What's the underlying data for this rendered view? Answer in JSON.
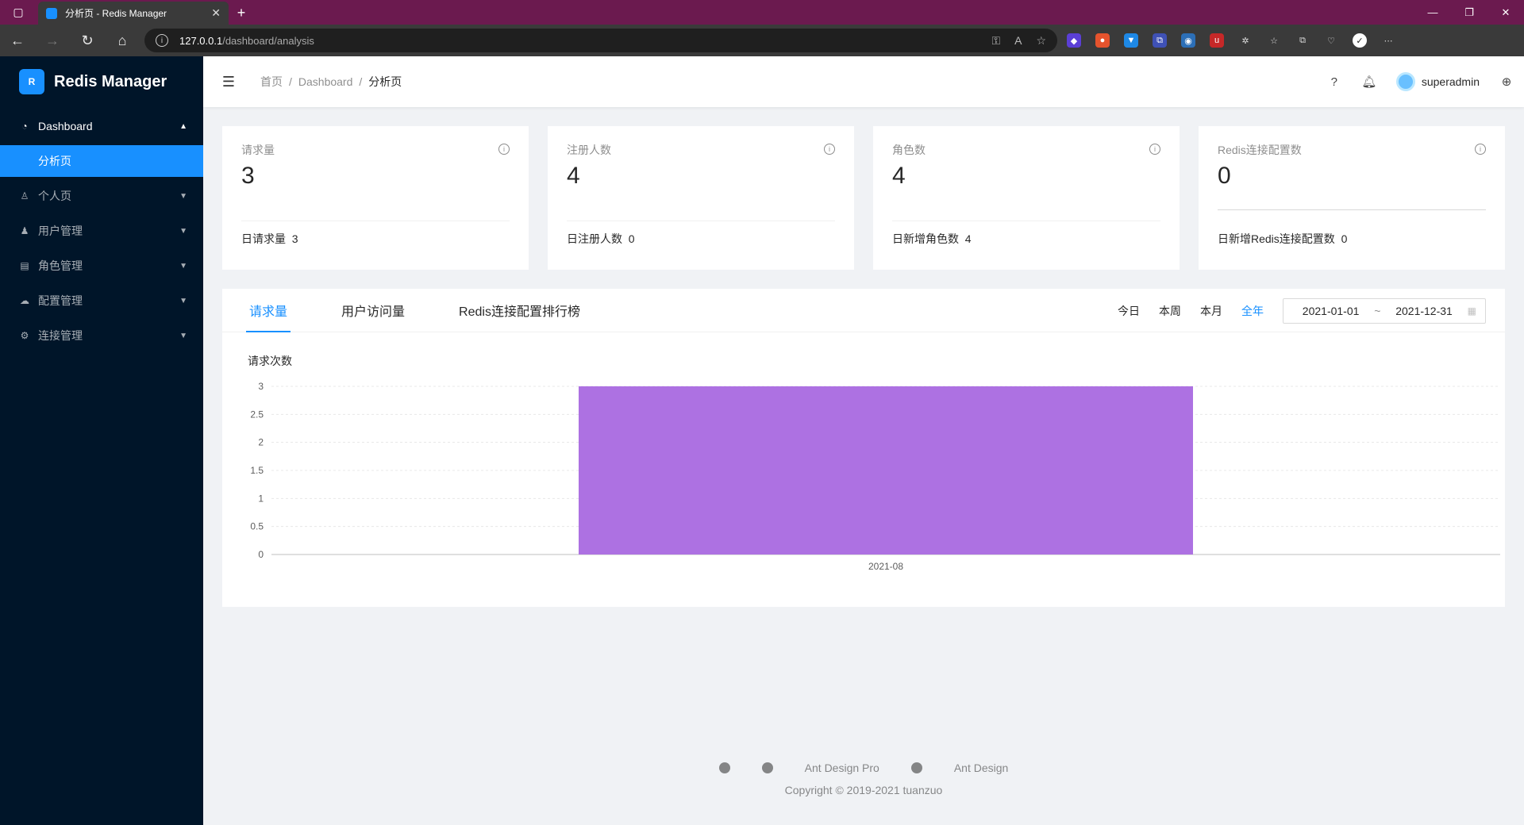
{
  "browser": {
    "tab_title": "分析页 - Redis Manager",
    "new_tab_icon": "plus-icon",
    "url_host": "127.0.0.1",
    "url_path": "/dashboard/analysis"
  },
  "app": {
    "logo_text": "Redis Manager"
  },
  "sidebar": {
    "items": [
      {
        "label": "Dashboard",
        "icon": "dashboard-icon",
        "open": true
      },
      {
        "label": "个人页",
        "icon": "user-icon"
      },
      {
        "label": "用户管理",
        "icon": "team-icon"
      },
      {
        "label": "角色管理",
        "icon": "role-icon"
      },
      {
        "label": "配置管理",
        "icon": "setting-cloud-icon"
      },
      {
        "label": "连接管理",
        "icon": "gear-icon"
      }
    ],
    "sub_items": [
      {
        "label": "分析页",
        "selected": true
      }
    ]
  },
  "header": {
    "breadcrumb": [
      "首页",
      "Dashboard",
      "分析页"
    ],
    "username": "superadmin"
  },
  "stats": [
    {
      "title": "请求量",
      "value": "3",
      "footer_label": "日请求量",
      "footer_value": "3"
    },
    {
      "title": "注册人数",
      "value": "4",
      "footer_label": "日注册人数",
      "footer_value": "0"
    },
    {
      "title": "角色数",
      "value": "4",
      "footer_label": "日新增角色数",
      "footer_value": "4"
    },
    {
      "title": "Redis连接配置数",
      "value": "0",
      "footer_label": "日新增Redis连接配置数",
      "footer_value": "0"
    }
  ],
  "sales": {
    "tabs": [
      "请求量",
      "用户访问量",
      "Redis连接配置排行榜"
    ],
    "active_tab": 0,
    "ranges": [
      "今日",
      "本周",
      "本月",
      "全年"
    ],
    "active_range": 3,
    "date_start": "2021-01-01",
    "date_separator": "~",
    "date_end": "2021-12-31",
    "chart_title": "请求次数"
  },
  "chart_data": {
    "type": "bar",
    "categories": [
      "2021-08"
    ],
    "values": [
      3
    ],
    "ylim": [
      0,
      3
    ],
    "yticks": [
      "0",
      "0.5",
      "1",
      "1.5",
      "2",
      "2.5",
      "3"
    ],
    "color": "#ad71e2",
    "grid": true
  },
  "footer": {
    "links": [
      "Ant Design Pro",
      "Ant Design"
    ],
    "copyright": "Copyright © 2019-2021 tuanzuo"
  }
}
